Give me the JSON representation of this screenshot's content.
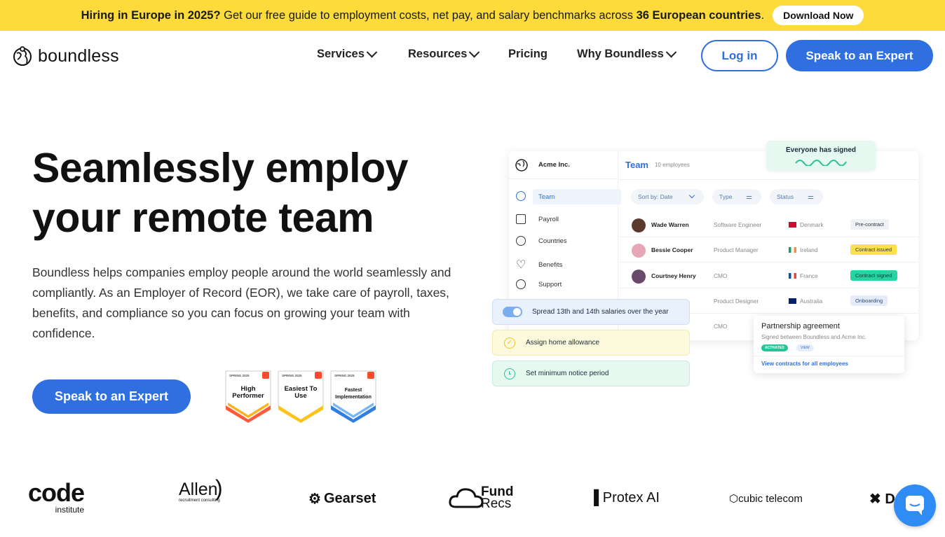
{
  "banner": {
    "text_pre": "Hiring in Europe in 2025?",
    "text_mid": " Get our free guide to employment costs, net pay, and salary benchmarks across ",
    "text_bold": "36 European countries",
    "text_end": ".",
    "button": "Download Now"
  },
  "nav": {
    "logo": "boundless",
    "items": [
      "Services",
      "Resources",
      "Pricing",
      "Why Boundless"
    ],
    "login": "Log in",
    "cta": "Speak to an Expert"
  },
  "hero": {
    "title_line1": "Seamlessly employ",
    "title_line2": "your remote team",
    "lead": "Boundless helps companies employ people around the world seamlessly and compliantly. As an Employer of Record (EOR), we take care of payroll, taxes, benefits, and compliance so you can focus on growing your team with confidence.",
    "cta": "Speak to an Expert"
  },
  "badges": [
    {
      "season": "SPRING 2025",
      "label": "High Performer"
    },
    {
      "season": "SPRING 2025",
      "label": "Easiest To Use"
    },
    {
      "season": "SPRING 2025",
      "label": "Fastest Implementation"
    }
  ],
  "app": {
    "company": "Acme Inc.",
    "sidebar": [
      "Team",
      "Payroll",
      "Countries",
      "Benefits",
      "Support"
    ],
    "team_title": "Team",
    "team_count": "10 employees",
    "filters": [
      "Sort by: Date",
      "Type",
      "Status"
    ],
    "rows": [
      {
        "name": "Wade Warren",
        "role": "Software Engineer",
        "country": "Denmark",
        "status": "Pre-contract"
      },
      {
        "name": "Bessie Cooper",
        "role": "Product Manager",
        "country": "Ireland",
        "status": "Contract issued"
      },
      {
        "name": "Courtney Henry",
        "role": "CMO",
        "country": "France",
        "status": "Contract signed"
      },
      {
        "name": "",
        "role": "Product Designer",
        "country": "Australia",
        "status": "Onboarding"
      },
      {
        "name": "",
        "role": "CMO",
        "country": "",
        "status": ""
      }
    ],
    "signed_toast": "Everyone has signed",
    "pills": [
      "Spread 13th and 14th salaries over the year",
      "Assign home allowance",
      "Set minimum notice period"
    ],
    "agreement": {
      "title": "Partnership agreement",
      "subtitle": "Signed between Boundless and Acme Inc.",
      "tag1": "ACTIVATED",
      "tag2": "VIEW",
      "link": "View contracts for all employees"
    }
  },
  "customer_logos": [
    "code",
    "institute",
    "Allen",
    "recruitment consulting",
    "Gearset",
    "Fund",
    "Recs",
    "Protex AI",
    "cubic telecom",
    "D",
    "x"
  ],
  "colors": {
    "banner": "#fcdb3a",
    "primary": "#2f6fe0",
    "chat": "#2f8cf4"
  }
}
